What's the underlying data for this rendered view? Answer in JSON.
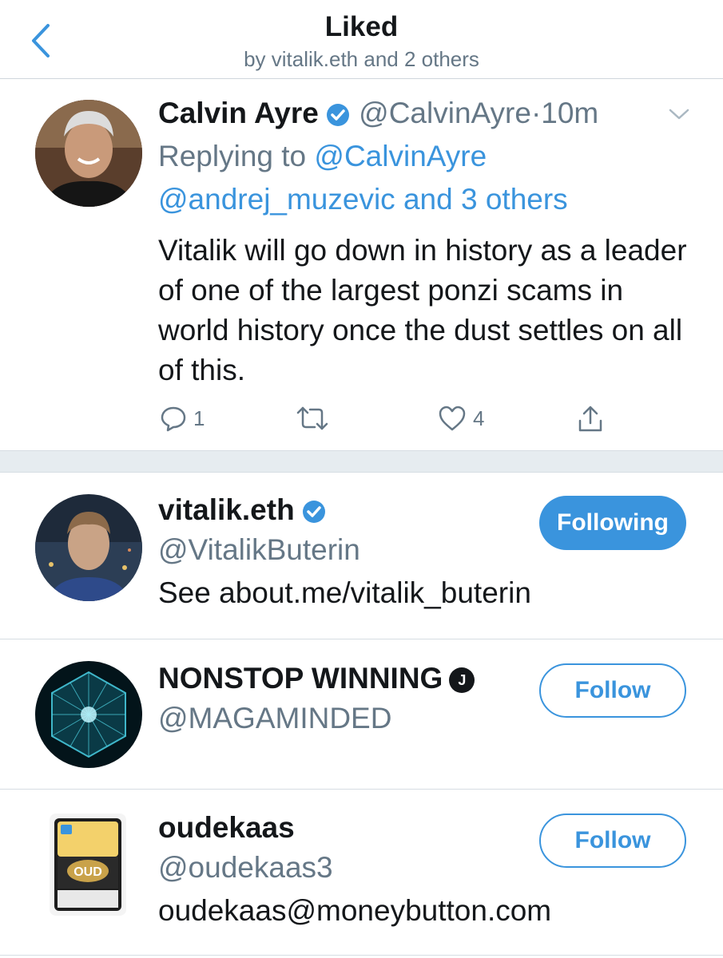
{
  "header": {
    "title": "Liked",
    "subtitle": "by vitalik.eth and 2 others"
  },
  "tweet": {
    "author_name": "Calvin Ayre",
    "author_handle": "@CalvinAyre",
    "separator": "·",
    "time": "10m",
    "replying_prefix": "Replying to",
    "replying_to_1": "@CalvinAyre",
    "replying_to_2": "@andrej_muzevic and 3 others",
    "text": "Vitalik will go down in history as a leader of one of the largest ponzi scams in world history once the dust settles on all of this.",
    "reply_count": "1",
    "like_count": "4"
  },
  "users": [
    {
      "name": "vitalik.eth",
      "handle": "@VitalikButerin",
      "bio": "See about.me/vitalik_buterin",
      "button": "Following",
      "badge": "verified"
    },
    {
      "name": "NONSTOP WINNING",
      "handle": "@MAGAMINDED",
      "badge_text": "J",
      "button": "Follow"
    },
    {
      "name": "oudekaas",
      "handle": "@oudekaas3",
      "bio": "oudekaas@moneybutton.com",
      "button": "Follow",
      "avatar_label": "OUD"
    }
  ],
  "colors": {
    "accent": "#3a94dd",
    "muted": "#657786",
    "text": "#14171a",
    "divider": "#e6ecf0"
  }
}
